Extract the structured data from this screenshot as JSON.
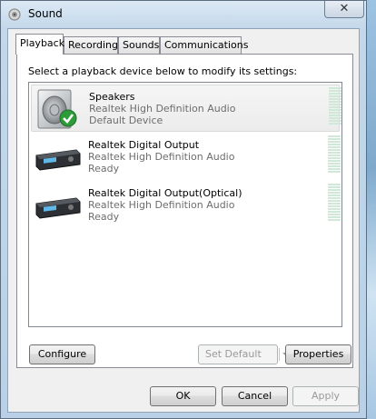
{
  "window": {
    "title": "Sound",
    "close_glyph": "✕"
  },
  "tabs": [
    {
      "label": "Playback",
      "active": true
    },
    {
      "label": "Recording",
      "active": false
    },
    {
      "label": "Sounds",
      "active": false
    },
    {
      "label": "Communications",
      "active": false
    }
  ],
  "instruction": "Select a playback device below to modify its settings:",
  "devices": [
    {
      "name": "Speakers",
      "driver": "Realtek High Definition Audio",
      "status": "Default Device",
      "icon": "speaker-icon",
      "default_badge": "check-badge-icon",
      "selected": true
    },
    {
      "name": "Realtek Digital Output",
      "driver": "Realtek High Definition Audio",
      "status": "Ready",
      "icon": "digital-output-device-icon",
      "selected": false
    },
    {
      "name": "Realtek Digital Output(Optical)",
      "driver": "Realtek High Definition Audio",
      "status": "Ready",
      "icon": "digital-output-device-icon",
      "selected": false
    }
  ],
  "buttons": {
    "configure": "Configure",
    "set_default": "Set Default",
    "properties": "Properties",
    "ok": "OK",
    "cancel": "Cancel",
    "apply": "Apply"
  },
  "colors": {
    "meter_empty": "#cfe8d8",
    "default_check": "#2e9b3a"
  }
}
